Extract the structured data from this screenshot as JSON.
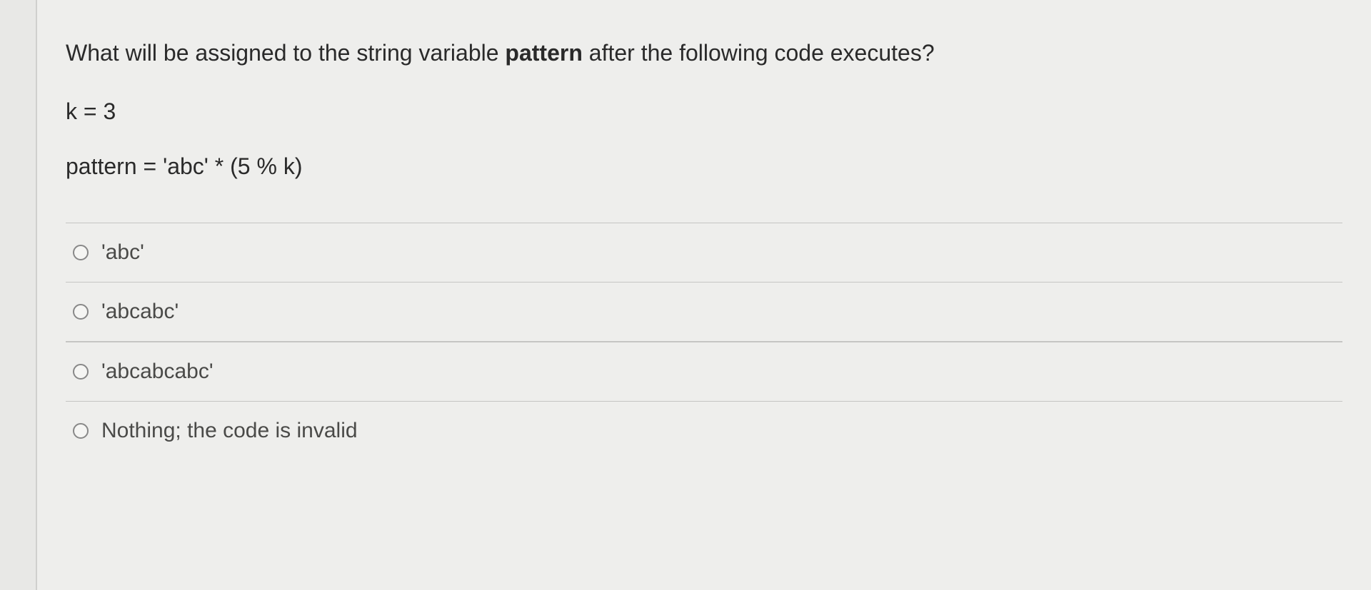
{
  "question": {
    "prefix": "What will be assigned to the string variable ",
    "bold": "pattern",
    "suffix": " after the following code executes?"
  },
  "code": {
    "line1": "k = 3",
    "line2": "pattern = 'abc' * (5 % k)"
  },
  "options": [
    {
      "label": "'abc'"
    },
    {
      "label": "'abcabc'"
    },
    {
      "label": "'abcabcabc'"
    },
    {
      "label": "Nothing; the code is invalid"
    }
  ]
}
